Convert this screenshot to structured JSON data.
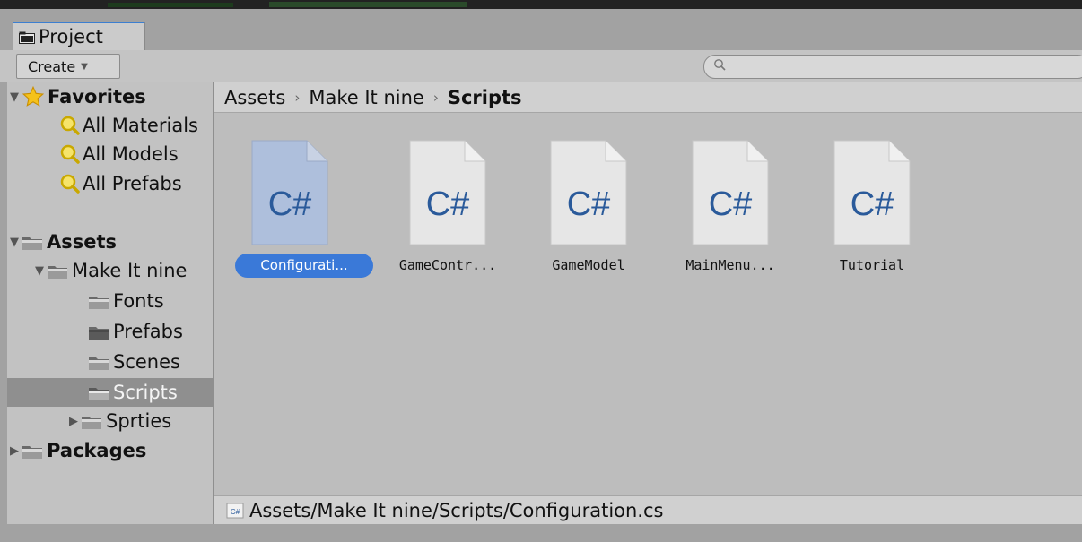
{
  "window": {
    "tab_label": "Project"
  },
  "toolbar": {
    "create_label": "Create",
    "search_placeholder": ""
  },
  "sidebar": {
    "favorites_label": "Favorites",
    "favorites": [
      {
        "label": "All Materials"
      },
      {
        "label": "All Models"
      },
      {
        "label": "All Prefabs"
      }
    ],
    "assets_label": "Assets",
    "make_it_nine_label": "Make It nine",
    "subfolders": [
      {
        "label": "Fonts"
      },
      {
        "label": "Prefabs"
      },
      {
        "label": "Scenes"
      },
      {
        "label": "Scripts",
        "selected": true
      },
      {
        "label": "Sprties"
      }
    ],
    "packages_label": "Packages"
  },
  "breadcrumb": {
    "items": [
      "Assets",
      "Make It nine",
      "Scripts"
    ],
    "separator": "›"
  },
  "assets": [
    {
      "label": "Configurati...",
      "icon_text": "C#",
      "selected": true
    },
    {
      "label": "GameContr...",
      "icon_text": "C#"
    },
    {
      "label": "GameModel",
      "icon_text": "C#"
    },
    {
      "label": "MainMenu...",
      "icon_text": "C#"
    },
    {
      "label": "Tutorial",
      "icon_text": "C#"
    }
  ],
  "status": {
    "path": "Assets/Make It nine/Scripts/Configuration.cs"
  },
  "colors": {
    "selection": "#3a79d8",
    "tab_accent": "#3c7fd0",
    "icon_text": "#2a5a9a"
  },
  "icons": {
    "tab": "folder-icon",
    "search": "search-icon",
    "favorites": "star-icon",
    "favorite_item": "magnifier-icon",
    "folder": "folder-icon",
    "script": "csharp-script-icon"
  }
}
